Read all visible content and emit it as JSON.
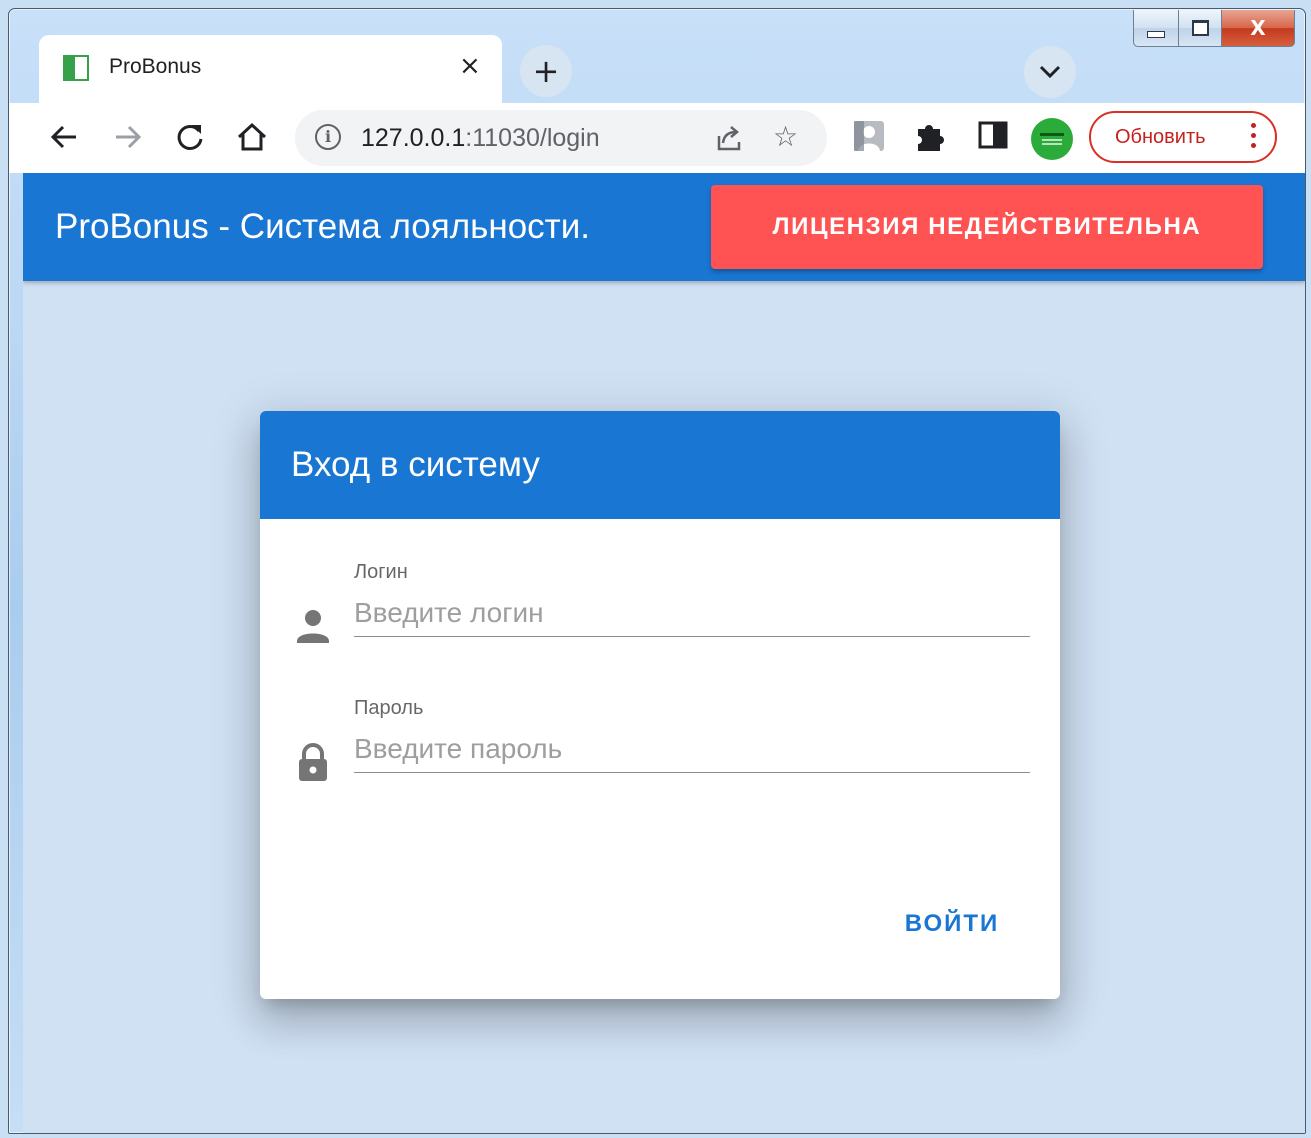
{
  "browser": {
    "tab": {
      "title": "ProBonus",
      "close_glyph": "×",
      "favicon": "probonus-favicon"
    },
    "new_tab_glyph": "+",
    "address": {
      "host": "127.0.0.1",
      "port_path": ":11030/login"
    },
    "update_button_label": "Обновить",
    "icons": [
      "back-arrow-icon",
      "forward-arrow-icon",
      "reload-icon",
      "home-icon",
      "info-icon",
      "share-icon",
      "star-icon",
      "profile-extension-icon",
      "puzzle-icon",
      "side-panel-icon",
      "kaspersky-icon",
      "more-vert-icon"
    ]
  },
  "window_controls": {
    "close_glyph": "X"
  },
  "appbar": {
    "title": "ProBonus - Система лояльности.",
    "license_button": "ЛИЦЕНЗИЯ НЕДЕЙСТВИТЕЛЬНА"
  },
  "login_card": {
    "title": "Вход в систему",
    "login": {
      "label": "Логин",
      "placeholder": "Введите логин",
      "value": ""
    },
    "password": {
      "label": "Пароль",
      "placeholder": "Введите пароль",
      "value": ""
    },
    "submit": "ВОЙТИ"
  },
  "colors": {
    "primary": "#1976d2",
    "danger": "#ff5252",
    "page_bg": "#d0e1f4"
  }
}
